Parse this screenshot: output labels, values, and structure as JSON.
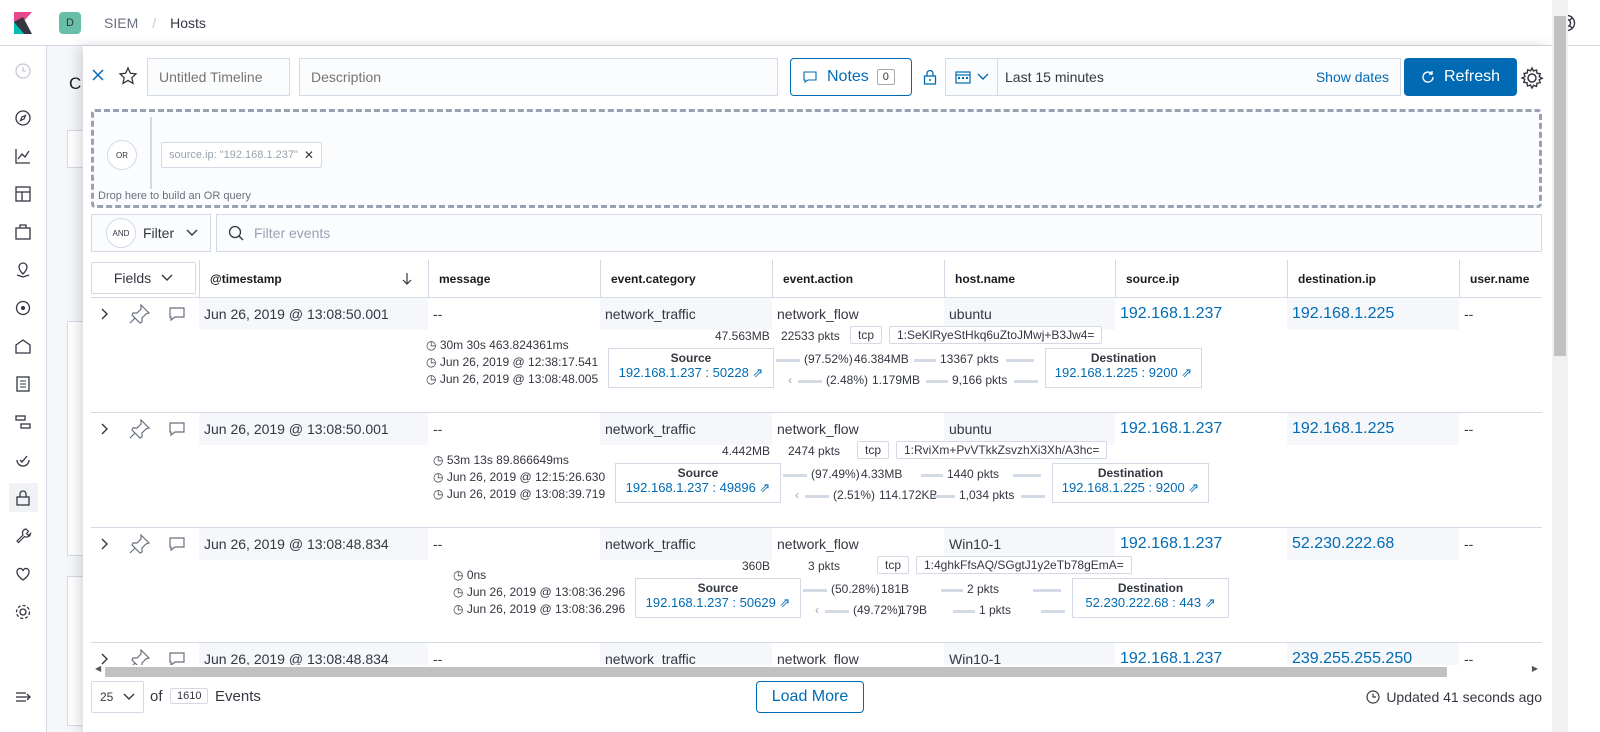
{
  "topbar": {
    "space_initial": "D",
    "breadcrumb": [
      "SIEM",
      "Hosts"
    ]
  },
  "background_page": {
    "letter": "C"
  },
  "timeline": {
    "title_placeholder": "Untitled Timeline",
    "description_placeholder": "Description",
    "notes_label": "Notes",
    "notes_count": "0",
    "date_range": "Last 15 minutes",
    "show_dates": "Show dates",
    "refresh_label": "Refresh"
  },
  "dropzone": {
    "or_label": "OR",
    "pill_text": "source.ip: \"192.168.1.237\"",
    "hint": "Drop here to build an OR query"
  },
  "filter_bar": {
    "and_label": "AND",
    "filter_label": "Filter",
    "search_placeholder": "Filter events"
  },
  "table": {
    "fields_label": "Fields",
    "columns": [
      "@timestamp",
      "message",
      "event.category",
      "event.action",
      "host.name",
      "source.ip",
      "destination.ip",
      "user.name"
    ],
    "rows": [
      {
        "timestamp": "Jun 26, 2019 @ 13:08:50.001",
        "message": "--",
        "category": "network_traffic",
        "action": "network_flow",
        "host": "ubuntu",
        "source_ip": "192.168.1.237",
        "dest_ip": "192.168.1.225",
        "user": "--",
        "flow": {
          "duration": "30m 30s 463.824361ms",
          "start": "Jun 26, 2019 @ 12:38:17.541",
          "end": "Jun 26, 2019 @ 13:08:48.005",
          "bytes": "47.563MB",
          "packets": "22533 pkts",
          "proto": "tcp",
          "community_id": "1:SeKlRyeStHkq6uZtoJMwj+B3Jw4=",
          "source_label": "Source",
          "source_addr": "192.168.1.237",
          "source_port": "50228",
          "dest_label": "Destination",
          "dest_addr": "192.168.1.225",
          "dest_port": "9200",
          "out_pct": "(97.52%)",
          "out_bytes": "46.384MB",
          "out_pkts": "13367 pkts",
          "in_pct": "(2.48%)",
          "in_bytes": "1.179MB",
          "in_pkts": "9,166 pkts"
        }
      },
      {
        "timestamp": "Jun 26, 2019 @ 13:08:50.001",
        "message": "--",
        "category": "network_traffic",
        "action": "network_flow",
        "host": "ubuntu",
        "source_ip": "192.168.1.237",
        "dest_ip": "192.168.1.225",
        "user": "--",
        "flow": {
          "duration": "53m 13s 89.866649ms",
          "start": "Jun 26, 2019 @ 12:15:26.630",
          "end": "Jun 26, 2019 @ 13:08:39.719",
          "bytes": "4.442MB",
          "packets": "2474 pkts",
          "proto": "tcp",
          "community_id": "1:RviXm+PvVTkkZsvzhXi3Xh/A3hc=",
          "source_label": "Source",
          "source_addr": "192.168.1.237",
          "source_port": "49896",
          "dest_label": "Destination",
          "dest_addr": "192.168.1.225",
          "dest_port": "9200",
          "out_pct": "(97.49%)",
          "out_bytes": "4.33MB",
          "out_pkts": "1440 pkts",
          "in_pct": "(2.51%)",
          "in_bytes": "114.172KB",
          "in_pkts": "1,034 pkts"
        }
      },
      {
        "timestamp": "Jun 26, 2019 @ 13:08:48.834",
        "message": "--",
        "category": "network_traffic",
        "action": "network_flow",
        "host": "Win10-1",
        "source_ip": "192.168.1.237",
        "dest_ip": "52.230.222.68",
        "user": "--",
        "flow": {
          "duration": "0ns",
          "start": "Jun 26, 2019 @ 13:08:36.296",
          "end": "Jun 26, 2019 @ 13:08:36.296",
          "bytes": "360B",
          "packets": "3 pkts",
          "proto": "tcp",
          "community_id": "1:4ghkFfsAQ/SGgtJ1y2eTb78gEmA=",
          "source_label": "Source",
          "source_addr": "192.168.1.237",
          "source_port": "50629",
          "dest_label": "Destination",
          "dest_addr": "52.230.222.68",
          "dest_port": "443",
          "out_pct": "(50.28%)",
          "out_bytes": "181B",
          "out_pkts": "2 pkts",
          "in_pct": "(49.72%)",
          "in_bytes": "179B",
          "in_pkts": "1 pkts"
        }
      },
      {
        "timestamp": "Jun 26, 2019 @ 13:08:48.834",
        "message": "--",
        "category": "network_traffic",
        "action": "network_flow",
        "host": "Win10-1",
        "source_ip": "192.168.1.237",
        "dest_ip": "239.255.255.250",
        "user": "--"
      }
    ]
  },
  "footer": {
    "per_page": "25",
    "of_label": "of",
    "total": "1610",
    "events_label": "Events",
    "load_more": "Load More",
    "updated": "Updated 41 seconds ago"
  }
}
